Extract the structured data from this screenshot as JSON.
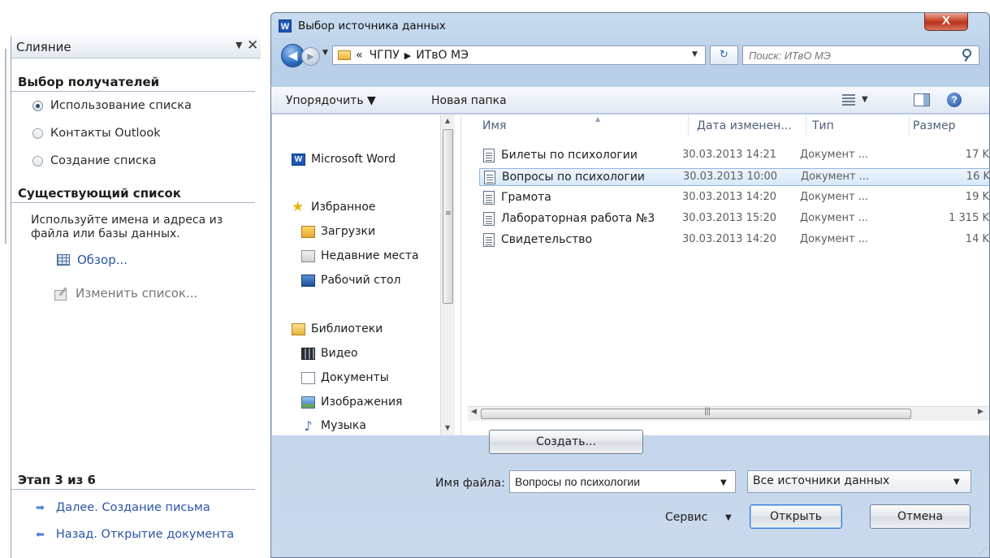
{
  "task_pane": {
    "title": "Слияние",
    "menu_glyph": "▼",
    "close_glyph": "✕",
    "section_recipients": "Выбор получателей",
    "options": [
      {
        "label": "Использование списка",
        "selected": true
      },
      {
        "label": "Контакты Outlook",
        "selected": false
      },
      {
        "label": "Создание списка",
        "selected": false
      }
    ],
    "section_existing": "Существующий список",
    "description": "Используйте имена и адреса из файла или базы данных.",
    "browse_link": "Обзор...",
    "edit_list_link": "Изменить список...",
    "step_label": "Этап 3 из 6",
    "next_link": "Далее. Создание письма",
    "back_link": "Назад. Открытие документа"
  },
  "dialog": {
    "title": "Выбор источника данных",
    "close_glyph": "X",
    "address": {
      "overflow": "«",
      "crumbs": [
        "ЧГПУ",
        "ИТвО МЭ"
      ]
    },
    "search_placeholder": "Поиск: ИТвО МЭ",
    "commands": {
      "organize": "Упорядочить ▼",
      "new_folder": "Новая папка"
    },
    "nav_items": [
      {
        "label": "Microsoft Word",
        "icon": "word-icon"
      },
      {
        "label": "Избранное",
        "icon": "star-icon"
      },
      {
        "label": "Загрузки",
        "icon": "downloads-icon"
      },
      {
        "label": "Недавние места",
        "icon": "recent-places-icon"
      },
      {
        "label": "Рабочий стол",
        "icon": "desktop-icon"
      },
      {
        "label": "Библиотеки",
        "icon": "libraries-icon"
      },
      {
        "label": "Видео",
        "icon": "video-icon"
      },
      {
        "label": "Документы",
        "icon": "documents-icon"
      },
      {
        "label": "Изображения",
        "icon": "images-icon"
      },
      {
        "label": "Музыка",
        "icon": "music-icon"
      }
    ],
    "columns": [
      "Имя",
      "Дата изменен...",
      "Тип",
      "Размер"
    ],
    "files": [
      {
        "name": "Билеты по психологии",
        "date": "30.03.2013 14:21",
        "type": "Документ ...",
        "size": "17 K",
        "selected": false
      },
      {
        "name": "Вопросы по психологии",
        "date": "30.03.2013 10:00",
        "type": "Документ ...",
        "size": "16 K",
        "selected": true
      },
      {
        "name": "Грамота",
        "date": "30.03.2013 14:20",
        "type": "Документ ...",
        "size": "19 K",
        "selected": false
      },
      {
        "name": "Лабораторная работа №3",
        "date": "30.03.2013 15:20",
        "type": "Документ ...",
        "size": "1 315 K",
        "selected": false
      },
      {
        "name": "Свидетельство",
        "date": "30.03.2013 14:20",
        "type": "Документ ...",
        "size": "14 K",
        "selected": false
      }
    ],
    "create_button": "Создать...",
    "filename_label": "Имя файла:",
    "filename_value": "Вопросы по психологии",
    "filetype_value": "Все источники данных",
    "service_label": "Сервис",
    "open_button": "Открыть",
    "cancel_button": "Отмена"
  }
}
